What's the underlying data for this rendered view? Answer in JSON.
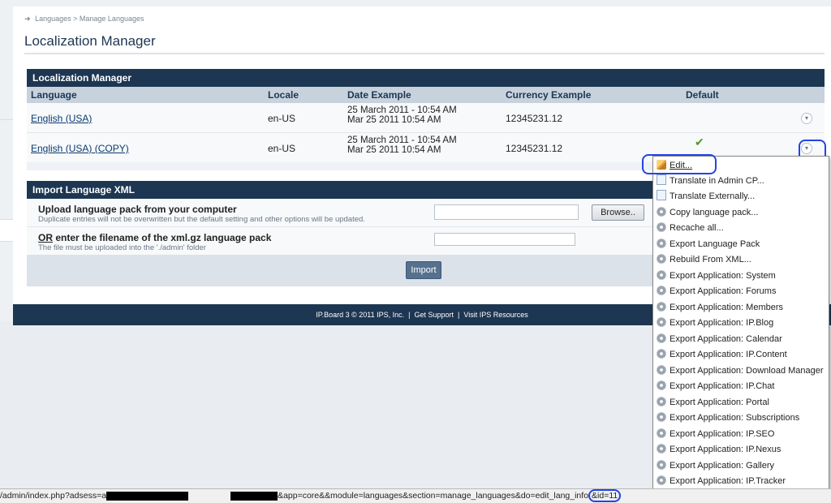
{
  "breadcrumb": {
    "items": [
      "Languages",
      "Manage Languages"
    ],
    "separator": ">"
  },
  "page_title": "Localization Manager",
  "lm_panel": {
    "title": "Localization Manager",
    "columns": [
      "Language",
      "Locale",
      "Date Example",
      "Currency Example",
      "Default"
    ],
    "rows": [
      {
        "language": "English (USA)",
        "locale": "en-US",
        "date_line1": "25 March 2011 - 10:54 AM",
        "date_line2": "Mar 25 2011 10:54 AM",
        "currency": "12345231.12",
        "default": false
      },
      {
        "language": "English (USA) (COPY)",
        "locale": "en-US",
        "date_line1": "25 March 2011 - 10:54 AM",
        "date_line2": "Mar 25 2011 10:54 AM",
        "currency": "12345231.12",
        "default": true
      }
    ]
  },
  "import_panel": {
    "title": "Import Language XML",
    "upload_label": "Upload language pack from your computer",
    "upload_desc": "Duplicate entries will not be overwritten but the default setting and other options will be updated.",
    "browse_label": "Browse..",
    "or_word": "OR",
    "filename_label": " enter the filename of the xml.gz language pack",
    "filename_desc": "The file must be uploaded into the './admin' folder",
    "import_label": "Import"
  },
  "footer": {
    "text": "IP.Board 3 © 2011 IPS, Inc.",
    "sep": "|",
    "link1": "Get Support",
    "link2": "Visit IPS Resources"
  },
  "menu": {
    "items": [
      {
        "label": "Edit...",
        "icon": "pencil-icon"
      },
      {
        "label": "Translate in Admin CP...",
        "icon": "page-icon"
      },
      {
        "label": "Translate Externally...",
        "icon": "page-icon"
      },
      {
        "label": "Copy language pack...",
        "icon": "gear-icon"
      },
      {
        "label": "Recache all...",
        "icon": "gear-icon"
      },
      {
        "label": "Export Language Pack",
        "icon": "gear-icon"
      },
      {
        "label": "Rebuild From XML...",
        "icon": "gear-icon"
      },
      {
        "label": "Export Application: System",
        "icon": "gear-icon"
      },
      {
        "label": "Export Application: Forums",
        "icon": "gear-icon"
      },
      {
        "label": "Export Application: Members",
        "icon": "gear-icon"
      },
      {
        "label": "Export Application: IP.Blog",
        "icon": "gear-icon"
      },
      {
        "label": "Export Application: Calendar",
        "icon": "gear-icon"
      },
      {
        "label": "Export Application: IP.Content",
        "icon": "gear-icon"
      },
      {
        "label": "Export Application: Download Manager",
        "icon": "gear-icon"
      },
      {
        "label": "Export Application: IP.Chat",
        "icon": "gear-icon"
      },
      {
        "label": "Export Application: Portal",
        "icon": "gear-icon"
      },
      {
        "label": "Export Application: Subscriptions",
        "icon": "gear-icon"
      },
      {
        "label": "Export Application: IP.SEO",
        "icon": "gear-icon"
      },
      {
        "label": "Export Application: IP.Nexus",
        "icon": "gear-icon"
      },
      {
        "label": "Export Application: Gallery",
        "icon": "gear-icon"
      },
      {
        "label": "Export Application: IP.Tracker",
        "icon": "gear-icon"
      }
    ]
  },
  "status_bar": {
    "prefix": "/admin/index.php?adsess=a",
    "middle": "&app=core&&module=languages&section=manage_languages&do=edit_lang_info",
    "suffix": "&id=11"
  },
  "colors": {
    "header_navy": "#1d3652",
    "highlight_blue": "#2343e6"
  }
}
